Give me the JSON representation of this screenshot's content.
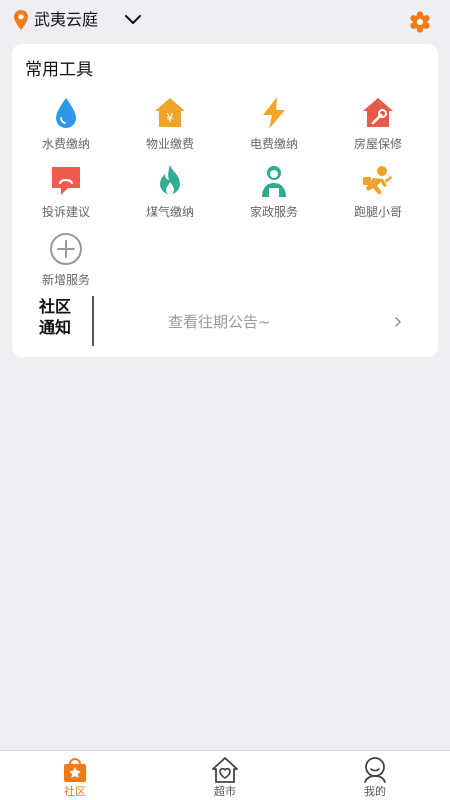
{
  "header": {
    "location": "武夷云庭",
    "icons": {
      "location": "location-pin-icon",
      "dropdown": "chevron-down-icon",
      "settings": "gear-icon"
    }
  },
  "colors": {
    "accent": "#f07a16",
    "water": "#2f97e8",
    "property": "#f0a42c",
    "electric": "#f6a623",
    "repair": "#ea5a4a",
    "complaint": "#ee5a4c",
    "gas": "#34ad96",
    "housekeeping": "#2fa98f",
    "errand": "#f1a22a"
  },
  "tools": {
    "title": "常用工具",
    "items": [
      {
        "label": "水费缴纳",
        "icon": "water-drop-icon"
      },
      {
        "label": "物业缴费",
        "icon": "house-yuan-icon"
      },
      {
        "label": "电费缴纳",
        "icon": "lightning-icon"
      },
      {
        "label": "房屋保修",
        "icon": "house-wrench-icon"
      },
      {
        "label": "投诉建议",
        "icon": "complaint-chat-icon"
      },
      {
        "label": "煤气缴纳",
        "icon": "flame-icon"
      },
      {
        "label": "家政服务",
        "icon": "housekeeper-icon"
      },
      {
        "label": "跑腿小哥",
        "icon": "runner-icon"
      },
      {
        "label": "新增服务",
        "icon": "plus-circle-icon"
      }
    ]
  },
  "notice": {
    "title": "社区通知",
    "text": "查看往期公告~"
  },
  "tabbar": {
    "items": [
      {
        "label": "社区",
        "icon": "community-bag-icon",
        "active": true
      },
      {
        "label": "超市",
        "icon": "market-house-heart-icon",
        "active": false
      },
      {
        "label": "我的",
        "icon": "profile-icon",
        "active": false
      }
    ]
  }
}
